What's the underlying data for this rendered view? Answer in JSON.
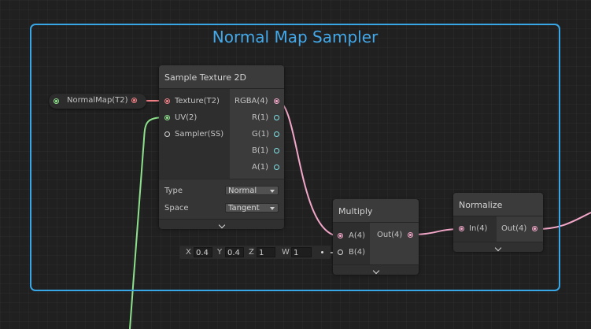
{
  "group": {
    "title": "Normal Map Sampler"
  },
  "property_node": {
    "label": "NormalMap(T2)"
  },
  "sample_texture": {
    "title": "Sample Texture 2D",
    "inputs": [
      "Texture(T2)",
      "UV(2)",
      "Sampler(SS)"
    ],
    "outputs": [
      "RGBA(4)",
      "R(1)",
      "G(1)",
      "B(1)",
      "A(1)"
    ],
    "type_label": "Type",
    "type_value": "Normal",
    "space_label": "Space",
    "space_value": "Tangent"
  },
  "multiply": {
    "title": "Multiply",
    "inputs": [
      "A(4)",
      "B(4)"
    ],
    "outputs": [
      "Out(4)"
    ]
  },
  "normalize": {
    "title": "Normalize",
    "inputs": [
      "In(4)"
    ],
    "outputs": [
      "Out(4)"
    ]
  },
  "vector_input": {
    "x_label": "X",
    "x_value": "0.4",
    "y_label": "Y",
    "y_value": "0.4",
    "z_label": "Z",
    "z_value": "1",
    "w_label": "W",
    "w_value": "1"
  },
  "colors": {
    "background": "#202020",
    "group_border": "#39a6e6",
    "vector4_wire": "#f2a6c8",
    "texture_port": "#f07f86",
    "vector2_wire": "#8de18d",
    "vector1_port": "#80e0e3"
  }
}
